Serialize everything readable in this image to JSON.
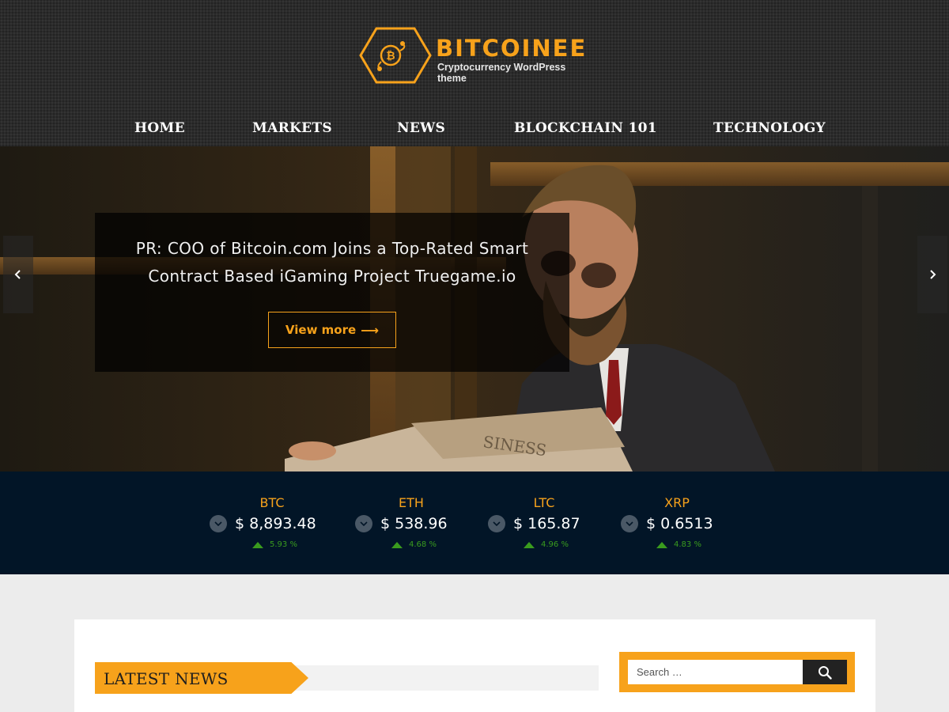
{
  "site": {
    "title": "BITCOINEE",
    "tagline": "Cryptocurrency WordPress theme",
    "logo_icon": "bitcoin-hexagon-icon"
  },
  "nav": {
    "items": [
      {
        "label": "HOME"
      },
      {
        "label": "MARKETS"
      },
      {
        "label": "NEWS"
      },
      {
        "label": "BLOCKCHAIN 101"
      },
      {
        "label": "TECHNOLOGY"
      }
    ]
  },
  "slider": {
    "title_line1": "PR: COO of Bitcoin.com Joins a Top-Rated Smart",
    "title_line2": "Contract Based iGaming Project Truegame.io",
    "button_label": "View more",
    "button_arrow": "⟶",
    "prev_icon": "chevron-left-icon",
    "next_icon": "chevron-right-icon"
  },
  "ticker": {
    "coins": [
      {
        "symbol": "BTC",
        "price": "$ 8,893.48",
        "change": "5.93 %",
        "direction": "up"
      },
      {
        "symbol": "ETH",
        "price": "$ 538.96",
        "change": "4.68 %",
        "direction": "up"
      },
      {
        "symbol": "LTC",
        "price": "$ 165.87",
        "change": "4.96 %",
        "direction": "up"
      },
      {
        "symbol": "XRP",
        "price": "$ 0.6513",
        "change": "4.83 %",
        "direction": "up"
      }
    ]
  },
  "main": {
    "section_title": "LATEST NEWS"
  },
  "sidebar": {
    "search_placeholder": "Search …",
    "search_icon": "search-icon"
  },
  "colors": {
    "accent": "#f7a21b",
    "header_bg": "#2b2b2b",
    "ticker_bg": "#021527",
    "up_green": "#3a9b1e",
    "page_bg": "#ececec"
  }
}
